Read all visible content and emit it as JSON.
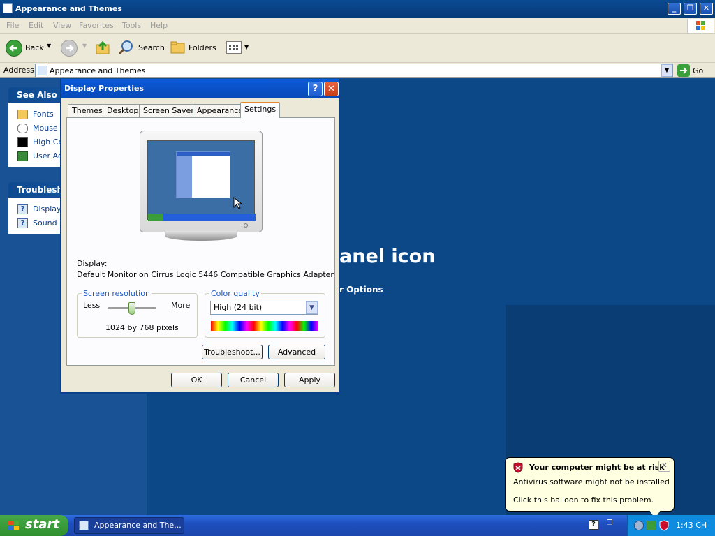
{
  "window": {
    "title": "Appearance and Themes"
  },
  "menu": [
    "File",
    "Edit",
    "View",
    "Favorites",
    "Tools",
    "Help"
  ],
  "toolbar": {
    "back": "Back",
    "search": "Search",
    "folders": "Folders"
  },
  "address": {
    "label": "Address",
    "value": "Appearance and Themes",
    "go": "Go"
  },
  "sidebar": {
    "see_also": {
      "title": "See Also",
      "items": [
        "Fonts",
        "Mouse P",
        "High Co",
        "User Ac"
      ]
    },
    "troubleshoot": {
      "title": "Troublesho",
      "items": [
        "Display",
        "Sound"
      ]
    }
  },
  "content": {
    "heading_fragment": "anel icon",
    "link_fragment": "r Options"
  },
  "dialog": {
    "title": "Display Properties",
    "help": "?",
    "close": "✕",
    "tabs": [
      "Themes",
      "Desktop",
      "Screen Saver",
      "Appearance",
      "Settings"
    ],
    "selected_tab": "Settings",
    "display_label": "Display:",
    "display_value": "Default Monitor on Cirrus Logic 5446 Compatible Graphics Adapter",
    "resolution": {
      "legend": "Screen resolution",
      "less": "Less",
      "more": "More",
      "value": "1024 by 768 pixels",
      "slider_level": 0.5
    },
    "color_quality": {
      "legend": "Color quality",
      "selected": "High (24 bit)"
    },
    "buttons": {
      "troubleshoot": "Troubleshoot...",
      "advanced": "Advanced",
      "ok": "OK",
      "cancel": "Cancel",
      "apply": "Apply"
    }
  },
  "balloon": {
    "title": "Your computer might be at risk",
    "line1": "Antivirus software might not be installed",
    "line2": "Click this balloon to fix this problem."
  },
  "taskbar": {
    "start": "start",
    "task": "Appearance and The...",
    "clock": "1:43 CH"
  },
  "colors": {
    "titlebar": "#0a4a92",
    "desktop": "#0c4787",
    "start_green": "#3a9d3a",
    "balloon": "#ffffe1"
  }
}
